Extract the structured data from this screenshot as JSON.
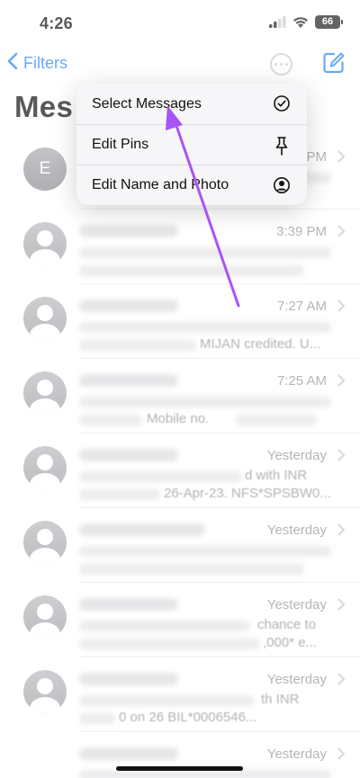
{
  "status_bar": {
    "time": "4:26",
    "battery": "66"
  },
  "nav": {
    "back_label": "Filters"
  },
  "title": "Mes",
  "menu": {
    "items": [
      {
        "label": "Select Messages",
        "icon": "checkmark-circle-icon"
      },
      {
        "label": "Edit Pins",
        "icon": "pin-icon"
      },
      {
        "label": "Edit Name and Photo",
        "icon": "person-circle-icon"
      }
    ]
  },
  "conversations": [
    {
      "avatar_letter": "E",
      "time": "PM",
      "snippet_1": "",
      "snippet_2": ""
    },
    {
      "avatar_letter": "",
      "time": "3:39 PM",
      "snippet_1": "",
      "snippet_2": ""
    },
    {
      "avatar_letter": "",
      "time": "7:27 AM",
      "snippet_1": "",
      "snippet_2": "MIJAN credited. U..."
    },
    {
      "avatar_letter": "",
      "time": "7:25 AM",
      "snippet_1": "",
      "snippet_2": "Mobile no."
    },
    {
      "avatar_letter": "",
      "time": "Yesterday",
      "snippet_1": "d with INR",
      "snippet_2": "26-Apr-23. NFS*SPSBW0..."
    },
    {
      "avatar_letter": "",
      "time": "Yesterday",
      "snippet_1": "",
      "snippet_2": ""
    },
    {
      "avatar_letter": "",
      "time": "Yesterday",
      "snippet_1": "chance to",
      "snippet_2": ",000* e..."
    },
    {
      "avatar_letter": "",
      "time": "Yesterday",
      "snippet_1": "th INR",
      "snippet_2": "0 on 26 BIL*0006546..."
    },
    {
      "avatar_letter": "",
      "time": "Yesterday",
      "snippet_1": "",
      "snippet_2": ""
    }
  ],
  "colors": {
    "accent": "#1a7cf5",
    "annotation": "#a855f7"
  }
}
